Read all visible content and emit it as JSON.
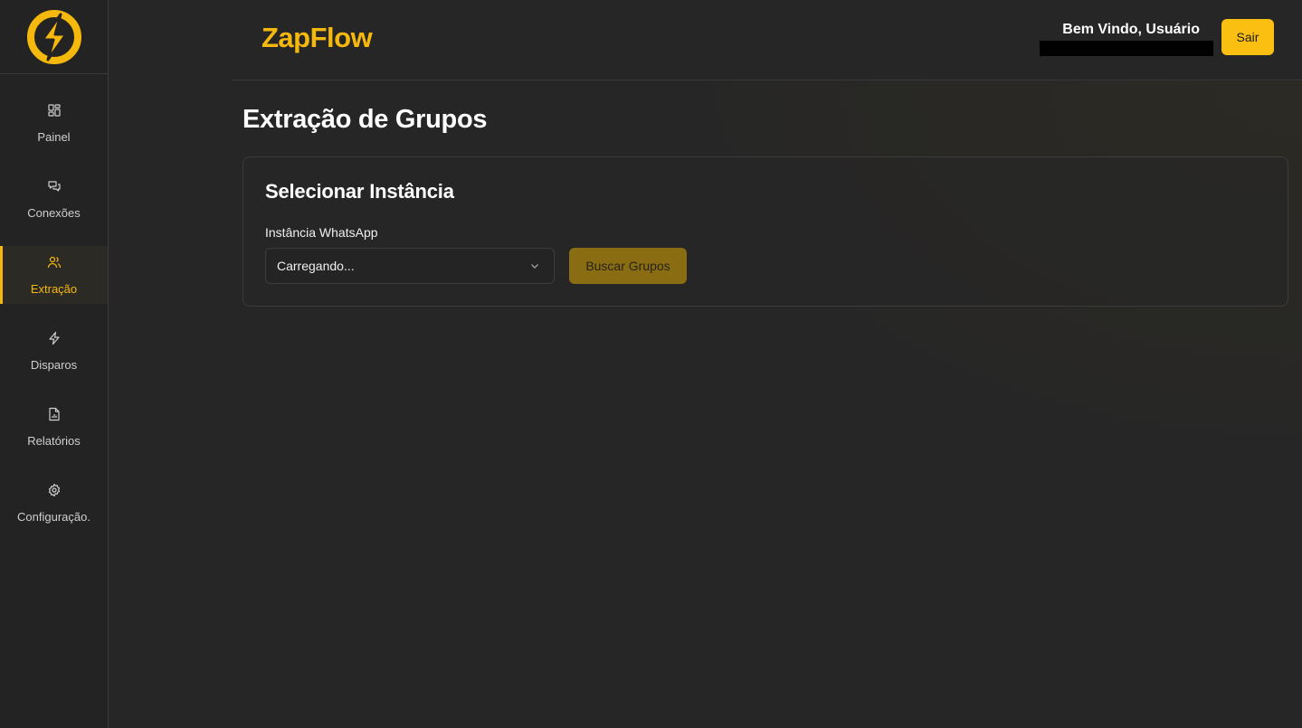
{
  "app": {
    "brand": "ZapFlow"
  },
  "colors": {
    "accent": "#f5b80d",
    "background": "#262626"
  },
  "sidebar": {
    "items": [
      {
        "label": "Painel",
        "icon": "dashboard-icon",
        "active": false
      },
      {
        "label": "Conexões",
        "icon": "chat-icon",
        "active": false
      },
      {
        "label": "Extração",
        "icon": "users-icon",
        "active": true
      },
      {
        "label": "Disparos",
        "icon": "lightning-icon",
        "active": false
      },
      {
        "label": "Relatórios",
        "icon": "report-icon",
        "active": false
      },
      {
        "label": "Configuração.",
        "icon": "gear-icon",
        "active": false
      }
    ]
  },
  "header": {
    "welcome": "Bem Vindo, Usuário",
    "logout_label": "Sair"
  },
  "main": {
    "title": "Extração de Grupos",
    "card": {
      "title": "Selecionar Instância",
      "instance_label": "Instância WhatsApp",
      "instance_value": "Carregando...",
      "search_button": "Buscar Grupos"
    }
  }
}
